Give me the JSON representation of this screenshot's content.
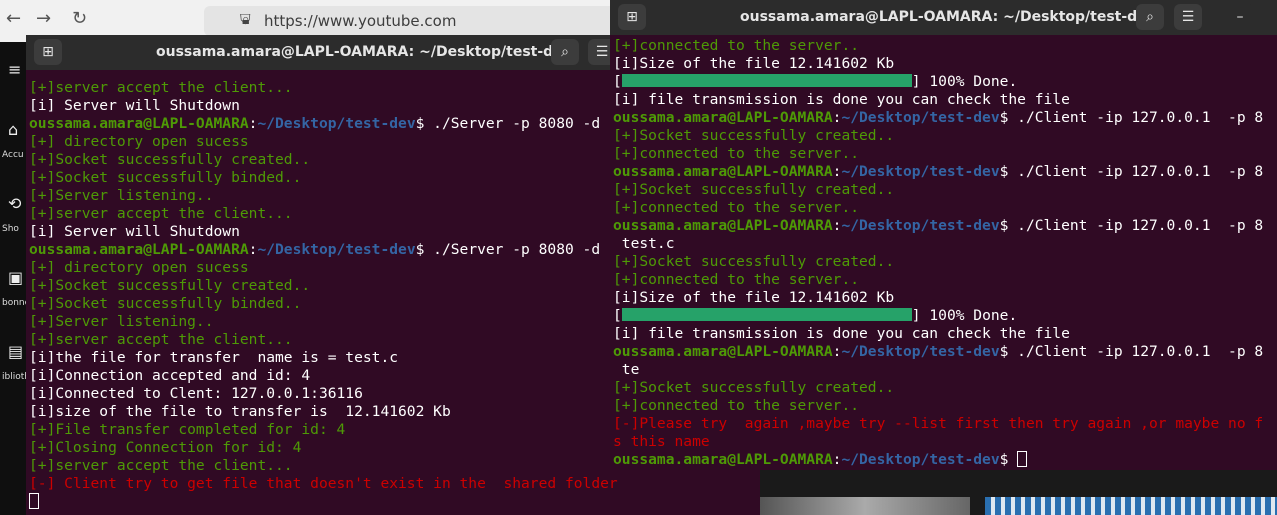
{
  "browser": {
    "back_icon": "arrow-left-icon",
    "forward_icon": "arrow-right-icon",
    "reload_icon": "reload-icon",
    "url": "https://www.youtube.com",
    "sidebar": [
      {
        "icon": "menu-icon",
        "label": ""
      },
      {
        "icon": "home-icon",
        "label": "Accu"
      },
      {
        "icon": "shorts-icon",
        "label": "Sho"
      },
      {
        "icon": "subscriptions-icon",
        "label": "bonne"
      },
      {
        "icon": "library-icon",
        "label": "iblioth"
      }
    ]
  },
  "terminal_left": {
    "title": "oussama.amara@LAPL-OAMARA: ~/Desktop/test-dev",
    "new_tab_icon": "new-tab-icon",
    "search_icon": "search-icon",
    "menu_icon": "hamburger-menu-icon",
    "lines": [
      {
        "type": "green",
        "text": "[+]server accept the client..."
      },
      {
        "type": "plain",
        "text": "[i] Server will Shutdown"
      },
      {
        "type": "prompt",
        "user": "oussama.amara@LAPL-OAMARA",
        "path": "~/Desktop/test-dev",
        "cmd": "$ ./Server -p 8080 -d"
      },
      {
        "type": "green",
        "text": "[+] directory open sucess"
      },
      {
        "type": "green",
        "text": "[+]Socket successfully created.."
      },
      {
        "type": "green",
        "text": "[+]Socket successfully binded.."
      },
      {
        "type": "green",
        "text": "[+]Server listening.."
      },
      {
        "type": "green",
        "text": "[+]server accept the client..."
      },
      {
        "type": "plain",
        "text": "[i] Server will Shutdown"
      },
      {
        "type": "prompt",
        "user": "oussama.amara@LAPL-OAMARA",
        "path": "~/Desktop/test-dev",
        "cmd": "$ ./Server -p 8080 -d"
      },
      {
        "type": "green",
        "text": "[+] directory open sucess"
      },
      {
        "type": "green",
        "text": "[+]Socket successfully created.."
      },
      {
        "type": "green",
        "text": "[+]Socket successfully binded.."
      },
      {
        "type": "green",
        "text": "[+]Server listening.."
      },
      {
        "type": "green",
        "text": "[+]server accept the client..."
      },
      {
        "type": "plain",
        "text": "[i]the file for transfer  name is = test.c"
      },
      {
        "type": "plain",
        "text": "[i]Connection accepted and id: 4"
      },
      {
        "type": "plain",
        "text": "[i]Connected to Clent: 127.0.0.1:36116"
      },
      {
        "type": "plain",
        "text": "[i]size of the file to transfer is  12.141602 Kb"
      },
      {
        "type": "green",
        "text": "[+]File transfer completed for id: 4"
      },
      {
        "type": "green",
        "text": "[+]Closing Connection for id: 4"
      },
      {
        "type": "green",
        "text": "[+]server accept the client..."
      },
      {
        "type": "red",
        "text": "[-] Client try to get file that doesn't exist in the  shared folder"
      },
      {
        "type": "cursor",
        "text": ""
      }
    ]
  },
  "terminal_right": {
    "title": "oussama.amara@LAPL-OAMARA: ~/Desktop/test-dev",
    "new_tab_icon": "new-tab-icon",
    "search_icon": "search-icon",
    "menu_icon": "hamburger-menu-icon",
    "minimize_icon": "minimize-icon",
    "lines": [
      {
        "type": "green",
        "text": "[+]connected to the server.."
      },
      {
        "type": "plain",
        "text": "[i]Size of the file 12.141602 Kb"
      },
      {
        "type": "progress",
        "progress": 1.0,
        "pre": "[",
        "post": "] 100% Done."
      },
      {
        "type": "plain",
        "text": "[i] file transmission is done you can check the file"
      },
      {
        "type": "prompt",
        "user": "oussama.amara@LAPL-OAMARA",
        "path": "~/Desktop/test-dev",
        "cmd": "$ ./Client -ip 127.0.0.1  -p 8"
      },
      {
        "type": "green",
        "text": "[+]Socket successfully created.."
      },
      {
        "type": "green",
        "text": "[+]connected to the server.."
      },
      {
        "type": "prompt",
        "user": "oussama.amara@LAPL-OAMARA",
        "path": "~/Desktop/test-dev",
        "cmd": "$ ./Client -ip 127.0.0.1  -p 8"
      },
      {
        "type": "green",
        "text": "[+]Socket successfully created.."
      },
      {
        "type": "green",
        "text": "[+]connected to the server.."
      },
      {
        "type": "prompt",
        "user": "oussama.amara@LAPL-OAMARA",
        "path": "~/Desktop/test-dev",
        "cmd": "$ ./Client -ip 127.0.0.1  -p 8"
      },
      {
        "type": "plain",
        "text": " test.c"
      },
      {
        "type": "green",
        "text": "[+]Socket successfully created.."
      },
      {
        "type": "green",
        "text": "[+]connected to the server.."
      },
      {
        "type": "plain",
        "text": "[i]Size of the file 12.141602 Kb"
      },
      {
        "type": "progress",
        "progress": 1.0,
        "pre": "[",
        "post": "] 100% Done."
      },
      {
        "type": "plain",
        "text": "[i] file transmission is done you can check the file"
      },
      {
        "type": "prompt",
        "user": "oussama.amara@LAPL-OAMARA",
        "path": "~/Desktop/test-dev",
        "cmd": "$ ./Client -ip 127.0.0.1  -p 8"
      },
      {
        "type": "plain",
        "text": " te"
      },
      {
        "type": "green",
        "text": "[+]Socket successfully created.."
      },
      {
        "type": "green",
        "text": "[+]connected to the server.."
      },
      {
        "type": "red",
        "text": "[-]Please try  again ,maybe try --list first then try again ,or maybe no f"
      },
      {
        "type": "red",
        "text": "s this name"
      },
      {
        "type": "prompt",
        "user": "oussama.amara@LAPL-OAMARA",
        "path": "~/Desktop/test-dev",
        "cmd": "$ ",
        "cursor": true
      }
    ]
  }
}
